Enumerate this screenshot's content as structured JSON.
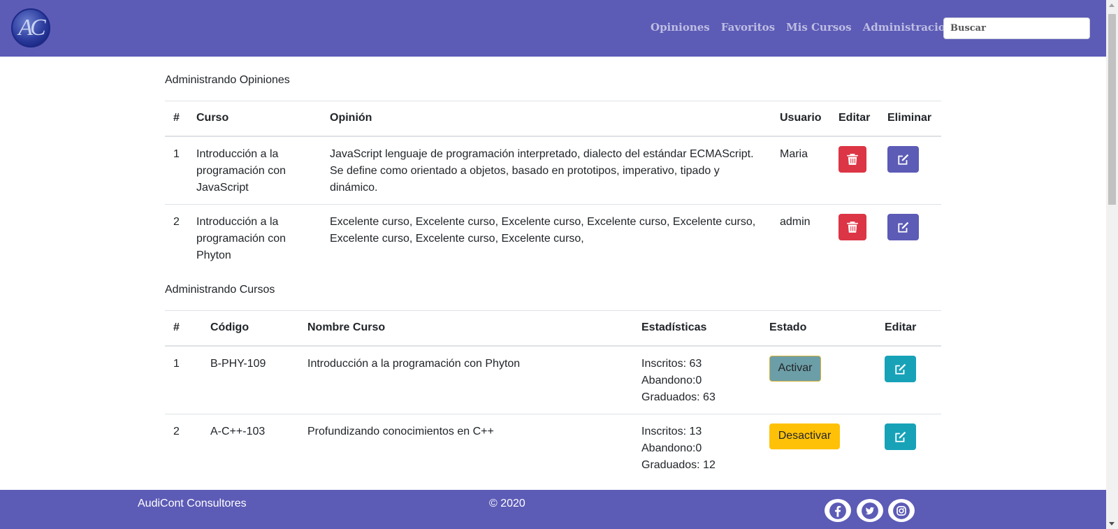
{
  "brand": {
    "logo_text": "AC"
  },
  "nav": {
    "links": [
      "Opiniones",
      "Favoritos",
      "Mis Cursos",
      "Administracion"
    ],
    "search_placeholder": "Buscar"
  },
  "opinions": {
    "title": "Administrando Opiniones",
    "headers": [
      "#",
      "Curso",
      "Opinión",
      "Usuario",
      "Editar",
      "Eliminar"
    ],
    "rows": [
      {
        "num": "1",
        "curso": "Introducción a la programación con JavaScript",
        "opinion": "JavaScript lenguaje de programación interpretado, dialecto del estándar ECMAScript. Se define como orientado a objetos,  basado en prototipos, imperativo, tipado y dinámico.",
        "usuario": "Maria"
      },
      {
        "num": "2",
        "curso": "Introducción a la programación con Phyton",
        "opinion": "Excelente curso, Excelente curso, Excelente curso, Excelente curso, Excelente curso, Excelente curso, Excelente curso, Excelente curso,",
        "usuario": "admin"
      }
    ]
  },
  "courses": {
    "title": "Administrando Cursos",
    "headers": [
      "#",
      "Código",
      "Nombre Curso",
      "Estadísticas",
      "Estado",
      "Editar"
    ],
    "rows": [
      {
        "num": "1",
        "codigo": "B-PHY-109",
        "nombre": "Introducción a la programación con Phyton",
        "inscritos": "Inscritos: 63",
        "abandono": "Abandono:0",
        "graduados": "Graduados: 63",
        "estado_label": "Activar"
      },
      {
        "num": "2",
        "codigo": "A-C++-103",
        "nombre": "Profundizando conocimientos en C++",
        "inscritos": "Inscritos: 13",
        "abandono": "Abandono:0",
        "graduados": "Graduados: 12",
        "estado_label": "Desactivar"
      }
    ]
  },
  "footer": {
    "brand": "AudiCont Consultores",
    "copyright": "© 2020",
    "social_icons": [
      "facebook-icon",
      "twitter-icon",
      "instagram-icon"
    ]
  },
  "colors": {
    "primary": "#5c5bb6",
    "danger": "#dc3545",
    "info": "#17a2b8",
    "warning": "#ffc107",
    "activar": "#6c9ea7"
  }
}
